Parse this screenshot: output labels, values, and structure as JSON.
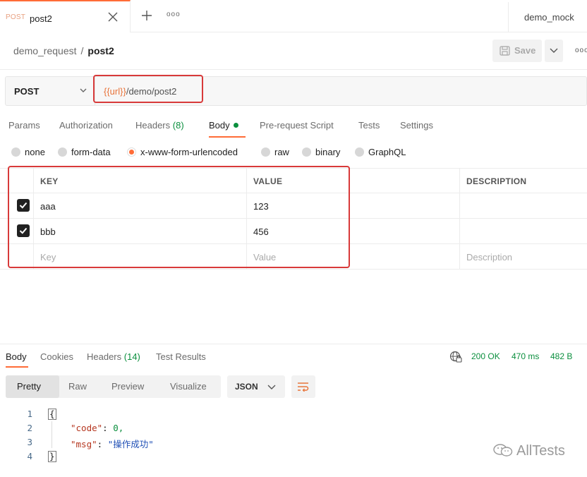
{
  "tab": {
    "method": "POST",
    "name": "post2",
    "close_icon": "close-icon",
    "more": "ooo"
  },
  "environment": "demo_mock",
  "breadcrumb": {
    "collection": "demo_request",
    "separator": "/",
    "request": "post2"
  },
  "toolbar": {
    "save_label": "Save",
    "more": "ooo"
  },
  "request": {
    "method": "POST",
    "url_variable": "{{url}}",
    "url_path": "/demo/post2"
  },
  "request_tabs": [
    {
      "label": "Params"
    },
    {
      "label": "Authorization"
    },
    {
      "label": "Headers",
      "count": "(8)"
    },
    {
      "label": "Body"
    },
    {
      "label": "Pre-request Script"
    },
    {
      "label": "Tests"
    },
    {
      "label": "Settings"
    }
  ],
  "body_types": [
    {
      "label": "none"
    },
    {
      "label": "form-data"
    },
    {
      "label": "x-www-form-urlencoded",
      "selected": true
    },
    {
      "label": "raw"
    },
    {
      "label": "binary"
    },
    {
      "label": "GraphQL"
    }
  ],
  "table": {
    "headers": {
      "key": "KEY",
      "value": "VALUE",
      "description": "DESCRIPTION"
    },
    "rows": [
      {
        "checked": true,
        "key": "aaa",
        "value": "123",
        "description": ""
      },
      {
        "checked": true,
        "key": "bbb",
        "value": "456",
        "description": ""
      }
    ],
    "placeholders": {
      "key": "Key",
      "value": "Value",
      "description": "Description"
    }
  },
  "response": {
    "tabs": [
      {
        "label": "Body"
      },
      {
        "label": "Cookies"
      },
      {
        "label": "Headers",
        "count": "(14)"
      },
      {
        "label": "Test Results"
      }
    ],
    "status": "200 OK",
    "time": "470 ms",
    "size": "482 B",
    "views": [
      "Pretty",
      "Raw",
      "Preview",
      "Visualize"
    ],
    "format": "JSON",
    "code_lines": [
      {
        "n": "1",
        "text": "{"
      },
      {
        "n": "2",
        "key": "\"code\"",
        "value": "0,"
      },
      {
        "n": "3",
        "key": "\"msg\"",
        "value": "\"操作成功\""
      },
      {
        "n": "4",
        "text": "}"
      }
    ]
  },
  "watermark": "AllTests",
  "colors": {
    "accent": "#ff6c37",
    "status_green": "#0b8f3e",
    "annotation_red": "#d83a3a",
    "url_variable": "#e8743b"
  }
}
